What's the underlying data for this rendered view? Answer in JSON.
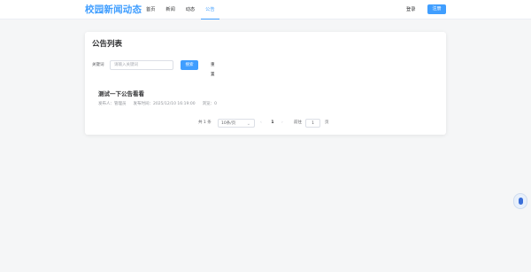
{
  "header": {
    "brand": "校园新闻动态",
    "nav": [
      "首页",
      "新闻",
      "动态",
      "公告"
    ],
    "active_nav": "公告",
    "login": "登录",
    "register": "注册"
  },
  "page": {
    "title": "公告列表"
  },
  "search": {
    "label": "关键词",
    "placeholder": "请输入关键词",
    "search_button": "搜索",
    "reset_button": "重置"
  },
  "notices": [
    {
      "title": "测试一下公告看看",
      "publisher": "发布人：管理员",
      "published_at": "发布时间：2025/12/10 16:19:00",
      "views": "浏览：0"
    }
  ],
  "pagination": {
    "total": "共 1 条",
    "page_size": "10条/页",
    "current_page": "1",
    "goto_label": "前往",
    "goto_value": "1",
    "page_unit": "页"
  },
  "icons": {
    "prev": "chevron-left-icon",
    "next": "chevron-right-icon",
    "dropdown": "chevron-down-icon",
    "float": "assistant-icon"
  },
  "colors": {
    "primary": "#409eff",
    "text": "#303133",
    "muted": "#909399"
  }
}
